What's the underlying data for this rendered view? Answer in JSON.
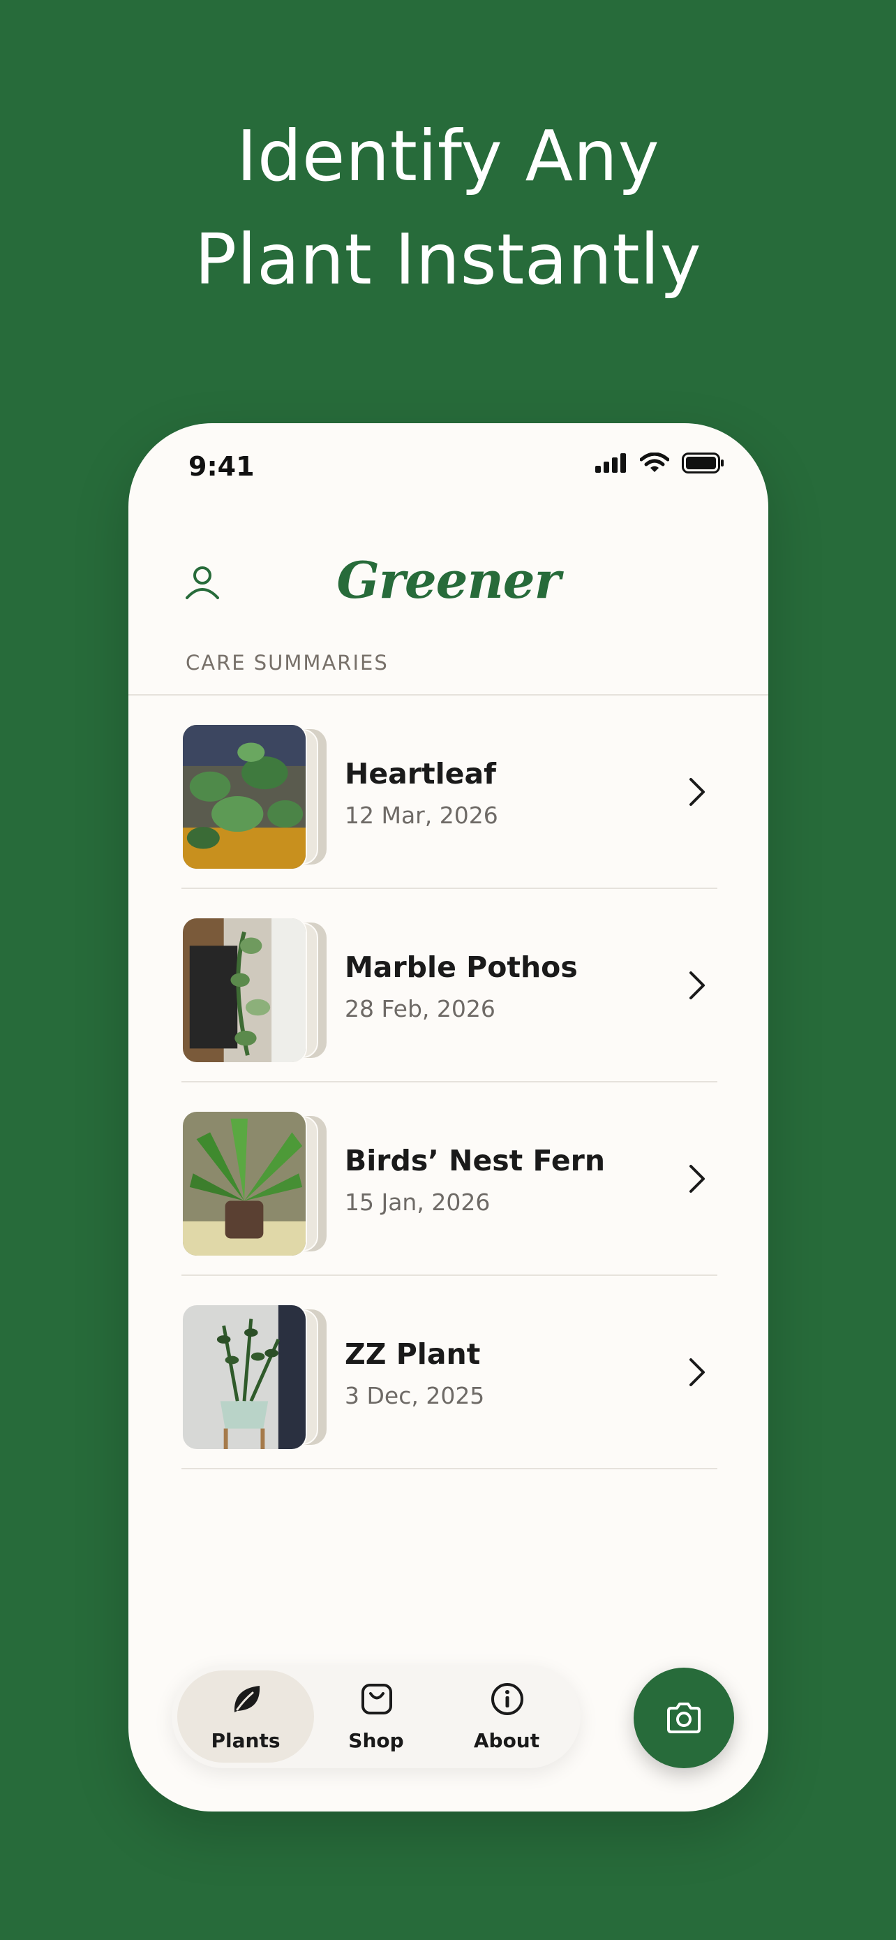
{
  "headline": {
    "line1": "Identify Any",
    "line2": "Plant Instantly"
  },
  "status_bar": {
    "time": "9:41"
  },
  "header": {
    "logo": "Greener",
    "profile_icon": "user-icon"
  },
  "section": {
    "title": "CARE SUMMARIES"
  },
  "plants": [
    {
      "name": "Heartleaf",
      "date": "12 Mar, 2026"
    },
    {
      "name": "Marble Pothos",
      "date": "28 Feb, 2026"
    },
    {
      "name": "Birds’ Nest Fern",
      "date": "15 Jan, 2026"
    },
    {
      "name": "ZZ Plant",
      "date": "3 Dec, 2025"
    }
  ],
  "tabbar": {
    "tabs": [
      {
        "label": "Plants",
        "icon": "leaf-icon",
        "active": true
      },
      {
        "label": "Shop",
        "icon": "shopping-bag-icon",
        "active": false
      },
      {
        "label": "About",
        "icon": "info-icon",
        "active": false
      }
    ]
  },
  "camera_button": {
    "icon": "camera-icon"
  },
  "colors": {
    "brand_green": "#276b3a",
    "screen_background": "#fdfbf8",
    "active_tab": "#ece7df"
  }
}
